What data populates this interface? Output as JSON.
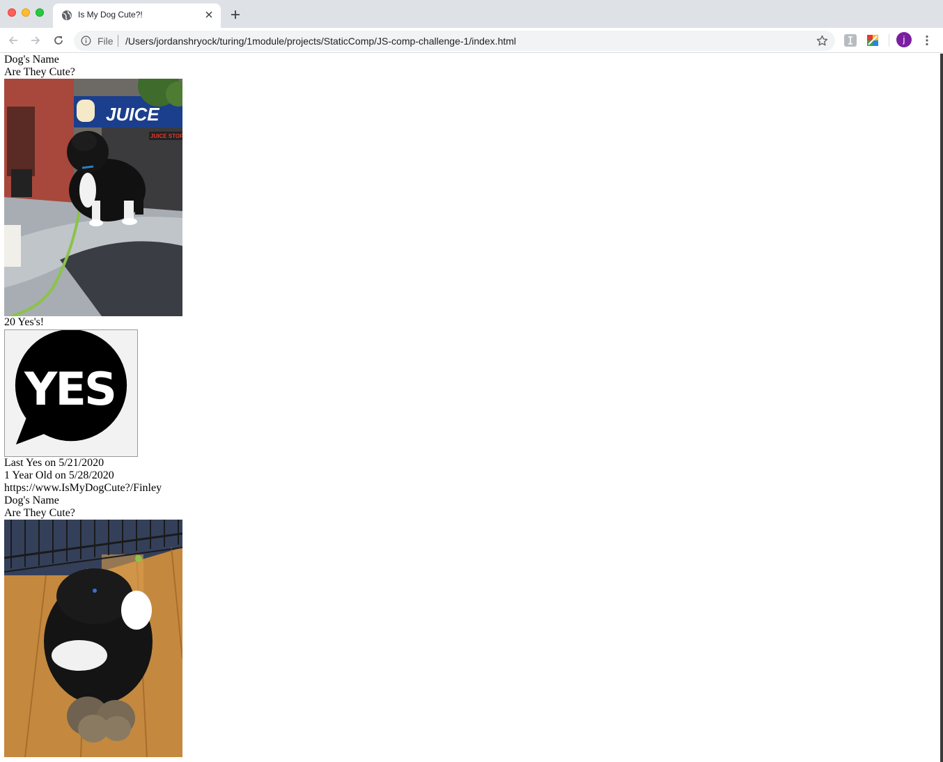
{
  "browser": {
    "tab_title": "Is My Dog Cute?!",
    "scheme_label": "File",
    "url": "/Users/jordanshryock/turing/1module/projects/StaticComp/JS-comp-challenge-1/index.html",
    "avatar_letter": "j"
  },
  "page": {
    "cards": [
      {
        "name_label": "Dog's Name",
        "question": "Are They Cute?"
      },
      {
        "name_label": "Dog's Name",
        "question": "Are They Cute?"
      }
    ],
    "yes_count": "20 Yes's!",
    "yes_image_text": "YES",
    "last_yes": "Last Yes on 5/21/2020",
    "birthday": "1 Year Old on 5/28/2020",
    "link": "https://www.IsMyDogCute?/Finley"
  }
}
